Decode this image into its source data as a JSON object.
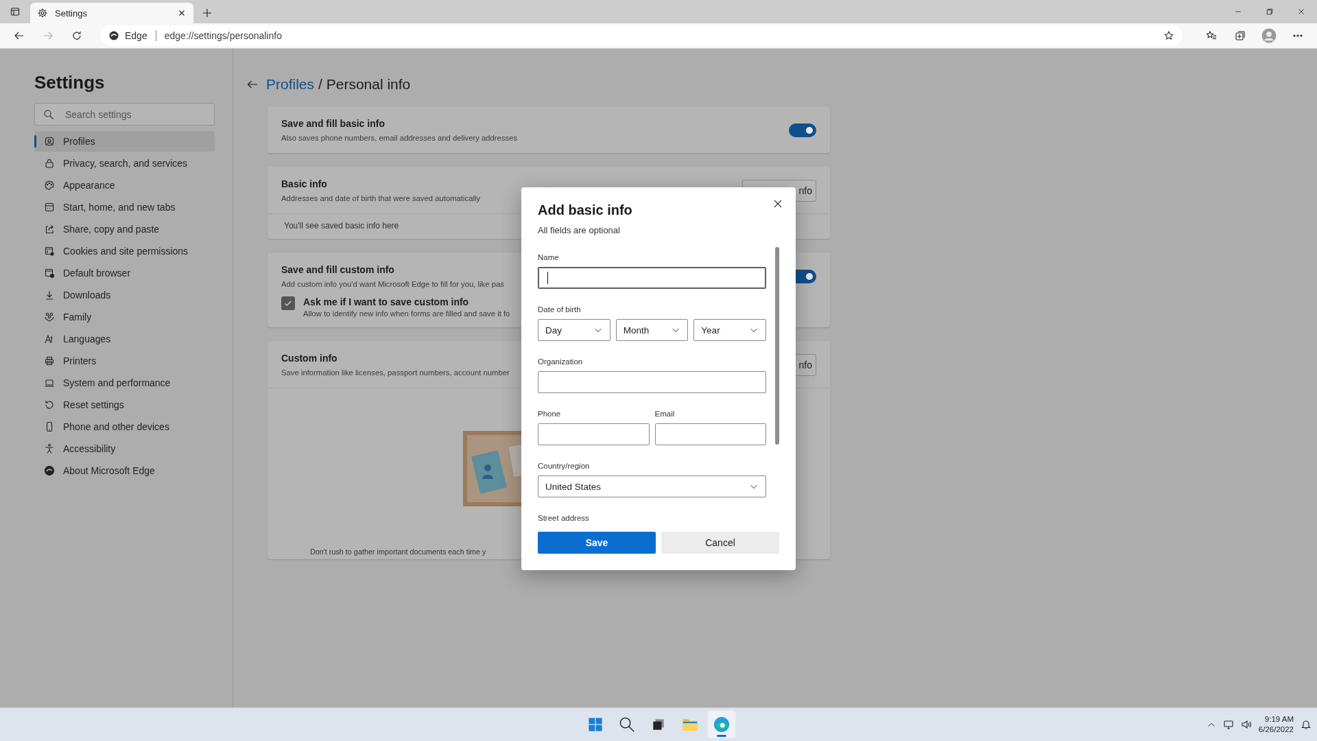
{
  "browser": {
    "tab": {
      "title": "Settings"
    },
    "address": {
      "site": "Edge",
      "url": "edge://settings/personalinfo"
    }
  },
  "sidebar": {
    "title": "Settings",
    "search": {
      "placeholder": "Search settings"
    },
    "items": [
      {
        "label": "Profiles",
        "selected": true
      },
      {
        "label": "Privacy, search, and services",
        "selected": false
      },
      {
        "label": "Appearance",
        "selected": false
      },
      {
        "label": "Start, home, and new tabs",
        "selected": false
      },
      {
        "label": "Share, copy and paste",
        "selected": false
      },
      {
        "label": "Cookies and site permissions",
        "selected": false
      },
      {
        "label": "Default browser",
        "selected": false
      },
      {
        "label": "Downloads",
        "selected": false
      },
      {
        "label": "Family",
        "selected": false
      },
      {
        "label": "Languages",
        "selected": false
      },
      {
        "label": "Printers",
        "selected": false
      },
      {
        "label": "System and performance",
        "selected": false
      },
      {
        "label": "Reset settings",
        "selected": false
      },
      {
        "label": "Phone and other devices",
        "selected": false
      },
      {
        "label": "Accessibility",
        "selected": false
      },
      {
        "label": "About Microsoft Edge",
        "selected": false
      }
    ]
  },
  "breadcrumb": {
    "link": "Profiles",
    "current": "/ Personal info"
  },
  "cards": [
    {
      "kind": "toggle",
      "title": "Save and fill basic info",
      "description": "Also saves phone numbers, email addresses and delivery addresses",
      "on": true
    },
    {
      "kind": "list",
      "title": "Basic info",
      "description": "Addresses and date of birth that were saved automatically",
      "button": "nfo",
      "empty_text": "You'll see saved basic info here"
    },
    {
      "kind": "toggle",
      "title": "Save and fill custom info",
      "description": "Add custom info you'd want Microsoft Edge to fill for you, like pas",
      "on": true,
      "checkbox": {
        "label": "Ask me if I want to save custom info",
        "description": "Allow to identify new info when forms are filled and save it fo",
        "checked": true
      }
    },
    {
      "kind": "illustration",
      "title": "Custom info",
      "description": "Save information like licenses, passport numbers, account number",
      "button": "nfo",
      "message": "Don't rush to gather important documents each time y"
    }
  ],
  "dialog": {
    "title": "Add basic info",
    "subtitle": "All fields are optional",
    "fields": [
      {
        "kind": "text",
        "label": "Name",
        "focused": true
      },
      {
        "kind": "date",
        "label": "Date of birth",
        "selects": [
          {
            "value": "Day"
          },
          {
            "value": "Month"
          },
          {
            "value": "Year"
          }
        ]
      },
      {
        "kind": "text",
        "label": "Organization",
        "focused": false
      },
      {
        "kind": "pair",
        "fields": [
          {
            "label": "Phone"
          },
          {
            "label": "Email"
          }
        ]
      },
      {
        "kind": "select",
        "label": "Country/region",
        "value": "United States"
      },
      {
        "kind": "label",
        "label": "Street address"
      }
    ],
    "buttons": [
      {
        "kind": "primary",
        "label": "Save"
      },
      {
        "kind": "secondary",
        "label": "Cancel"
      }
    ]
  },
  "taskbar": {
    "time": "9:19 AM",
    "date": "6/26/2022"
  }
}
